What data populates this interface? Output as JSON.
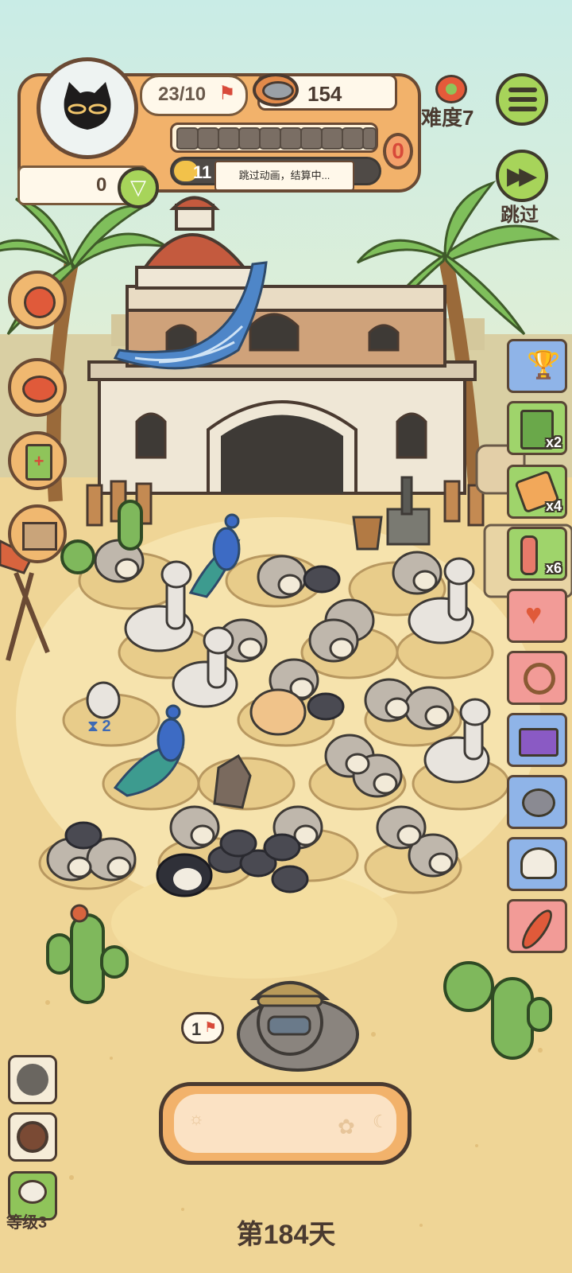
{
  "player": {
    "avatar_icon": "black-cat-icon",
    "flags": "23/10",
    "coins": "0"
  },
  "food": {
    "count": "154",
    "icon": "cat-food-can-icon"
  },
  "progress": {
    "segments_filled": 0,
    "segments_total": 10,
    "reward_badge": "0",
    "xp_value": "11"
  },
  "toast": "跳过动画，结算中...",
  "difficulty": "难度7",
  "menu_icon": "menu-icon",
  "skip": {
    "label": "跳过",
    "icon": "fast-forward-icon"
  },
  "left_buttons": [
    {
      "icon": "cat-face-icon"
    },
    {
      "icon": "food-bowl-icon"
    },
    {
      "icon": "medkit-icon"
    },
    {
      "icon": "box-icon"
    }
  ],
  "right_items": [
    {
      "icon": "trophy-icon",
      "badge": "",
      "color": "#8fb4e8"
    },
    {
      "icon": "cookie-card-icon",
      "badge": "x2",
      "color": "#9fd46b"
    },
    {
      "icon": "ticket-icon",
      "badge": "x4",
      "color": "#9fd46b"
    },
    {
      "icon": "worms-icon",
      "badge": "x6",
      "color": "#9fd46b"
    },
    {
      "icon": "gift-icon",
      "badge": "",
      "color": "#f29b97"
    },
    {
      "icon": "rope-icon",
      "badge": "",
      "color": "#f29b97"
    },
    {
      "icon": "card-icon",
      "badge": "",
      "color": "#8fb4e8"
    },
    {
      "icon": "mouse-icon",
      "badge": "",
      "color": "#8fb4e8"
    },
    {
      "icon": "wool-hat-icon",
      "badge": "",
      "color": "#8fb4e8"
    },
    {
      "icon": "feather-icon",
      "badge": "",
      "color": "#f29b97"
    }
  ],
  "field": {
    "hourglass_count": "2",
    "ranger_flag": "1"
  },
  "bottom_buttons": [
    {
      "icon": "cat-silhouette-icon"
    },
    {
      "icon": "coconut-icon"
    },
    {
      "icon": "frog-icon"
    }
  ],
  "level_label": "等级3",
  "day_label": "第184天",
  "colors": {
    "sky": "#bfe8e0",
    "sand": "#efd596",
    "panel": "#f2b26b",
    "accent_green": "#a7d45a"
  }
}
